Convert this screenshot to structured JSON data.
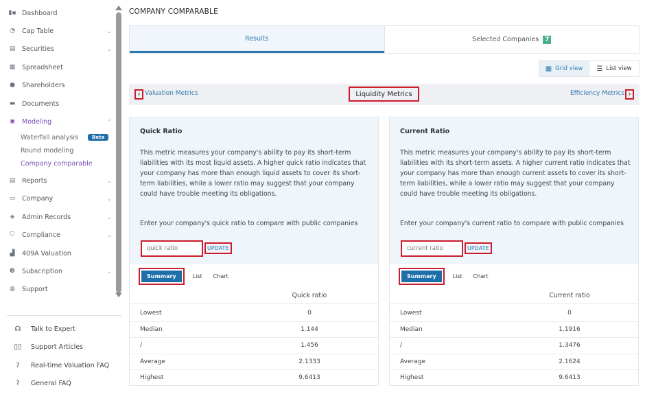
{
  "sidebar": {
    "items": [
      {
        "label": "Dashboard",
        "icon": "dashboard-icon",
        "glyph": "▮▪",
        "chevron": false
      },
      {
        "label": "Cap Table",
        "icon": "pie-chart-icon",
        "glyph": "◔",
        "chevron": true
      },
      {
        "label": "Securities",
        "icon": "clipboard-icon",
        "glyph": "▤",
        "chevron": true
      },
      {
        "label": "Spreadsheet",
        "icon": "spreadsheet-icon",
        "glyph": "▦",
        "chevron": false
      },
      {
        "label": "Shareholders",
        "icon": "person-icon",
        "glyph": "●",
        "chevron": false
      },
      {
        "label": "Documents",
        "icon": "folder-icon",
        "glyph": "▬",
        "chevron": false
      },
      {
        "label": "Modeling",
        "icon": "lightbulb-icon",
        "glyph": "◉",
        "chevron": true
      },
      {
        "label": "Reports",
        "icon": "report-icon",
        "glyph": "▤",
        "chevron": true
      },
      {
        "label": "Company",
        "icon": "briefcase-icon",
        "glyph": "▭",
        "chevron": true
      },
      {
        "label": "Admin Records",
        "icon": "admin-records-icon",
        "glyph": "◈",
        "chevron": true
      },
      {
        "label": "Compliance",
        "icon": "shield-icon",
        "glyph": "⛉",
        "chevron": true
      },
      {
        "label": "409A Valuation",
        "icon": "bar-chart-icon",
        "glyph": "▟",
        "chevron": false
      },
      {
        "label": "Subscription",
        "icon": "dollar-icon",
        "glyph": "❸",
        "chevron": true
      },
      {
        "label": "Support",
        "icon": "support-icon",
        "glyph": "◍",
        "chevron": false
      }
    ],
    "modeling_sub": {
      "waterfall": "Waterfall analysis",
      "beta": "Beta",
      "round": "Round modeling",
      "comparable": "Company comparable"
    },
    "help": [
      {
        "label": "Talk to Expert",
        "icon": "headset-icon",
        "glyph": "☊"
      },
      {
        "label": "Support Articles",
        "icon": "book-icon",
        "glyph": "▯▯"
      },
      {
        "label": "Real-time Valuation FAQ",
        "icon": "question-icon",
        "glyph": "?"
      },
      {
        "label": "General FAQ",
        "icon": "question-icon",
        "glyph": "?"
      }
    ]
  },
  "page": {
    "title": "COMPANY COMPARABLE",
    "tabs": {
      "results": "Results",
      "selected": "Selected Companies",
      "selected_count": "7"
    },
    "view": {
      "grid": "Grid view",
      "list": "List view"
    },
    "metrics": {
      "prev": "Valuation Metrics",
      "current": "Liquidity Metrics",
      "next": "Efficiency Metrics"
    }
  },
  "cards": [
    {
      "title": "Quick Ratio",
      "description": "This metric measures your company's ability to pay its short-term liabilities with its most liquid assets. A higher quick ratio indicates that your company has more than enough liquid assets to cover its short-term liabilities, while a lower ratio may suggest that your company could have trouble meeting its obligations.",
      "prompt": "Enter your company's quick ratio to compare with public companies",
      "placeholder": "quick ratio",
      "update": "UPDATE",
      "subtabs": {
        "summary": "Summary",
        "list": "List",
        "chart": "Chart"
      },
      "column": "Quick ratio",
      "rows": [
        {
          "k": "Lowest",
          "v": "0"
        },
        {
          "k": "Median",
          "v": "1.144"
        },
        {
          "k": "/",
          "v": "1.456"
        },
        {
          "k": "Average",
          "v": "2.1333"
        },
        {
          "k": "Highest",
          "v": "9.6413"
        }
      ]
    },
    {
      "title": "Current Ratio",
      "description": "This metric measures your company's ability to pay its short-term liabilities with its short-term assets. A higher current ratio indicates that your company has more than enough current assets to cover its short-term liabilities, while a lower ratio may suggest that your company could have trouble meeting its obligations.",
      "prompt": "Enter your company's current ratio to compare with public companies",
      "placeholder": "current ratio",
      "update": "UPDATE",
      "subtabs": {
        "summary": "Summary",
        "list": "List",
        "chart": "Chart"
      },
      "column": "Current ratio",
      "rows": [
        {
          "k": "Lowest",
          "v": "0"
        },
        {
          "k": "Median",
          "v": "1.1916"
        },
        {
          "k": "/",
          "v": "1.3476"
        },
        {
          "k": "Average",
          "v": "2.1624"
        },
        {
          "k": "Highest",
          "v": "9.6413"
        }
      ]
    }
  ],
  "colors": {
    "accent": "#2d78ad",
    "modeling": "#7a4fb5",
    "highlight": "#cc1b2a",
    "badge": "#4bae8f"
  }
}
